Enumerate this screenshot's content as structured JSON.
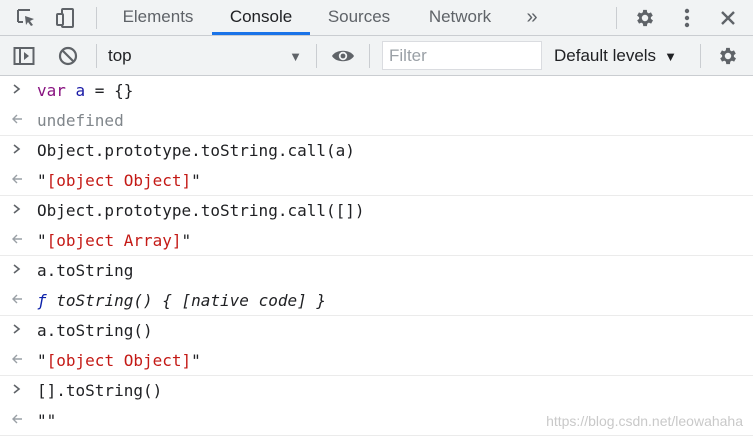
{
  "tabs": [
    {
      "label": "Elements",
      "active": false
    },
    {
      "label": "Console",
      "active": true
    },
    {
      "label": "Sources",
      "active": false
    },
    {
      "label": "Network",
      "active": false
    }
  ],
  "more_tabs_label": "»",
  "toolbar": {
    "context_value": "top",
    "filter_placeholder": "Filter",
    "levels_label": "Default levels"
  },
  "entries": [
    {
      "kind": "input",
      "parts": [
        {
          "t": "var",
          "c": "kw"
        },
        {
          "t": " a",
          "c": "var"
        },
        {
          "t": " = {}",
          "c": ""
        }
      ]
    },
    {
      "kind": "output",
      "parts": [
        {
          "t": "undefined",
          "c": "undef"
        }
      ]
    },
    {
      "kind": "input",
      "parts": [
        {
          "t": "Object.prototype.toString.call(a)",
          "c": ""
        }
      ]
    },
    {
      "kind": "output",
      "parts": [
        {
          "t": "\"",
          "c": ""
        },
        {
          "t": "[object Object]",
          "c": "str"
        },
        {
          "t": "\"",
          "c": ""
        }
      ]
    },
    {
      "kind": "input",
      "parts": [
        {
          "t": "Object.prototype.toString.call([])",
          "c": ""
        }
      ]
    },
    {
      "kind": "output",
      "parts": [
        {
          "t": "\"",
          "c": ""
        },
        {
          "t": "[object Array]",
          "c": "str"
        },
        {
          "t": "\"",
          "c": ""
        }
      ]
    },
    {
      "kind": "input",
      "parts": [
        {
          "t": "a.toString",
          "c": ""
        }
      ]
    },
    {
      "kind": "output",
      "parts": [
        {
          "t": "ƒ",
          "c": "fn-f"
        },
        {
          "t": " toString() { [native code] }",
          "c": "fn"
        }
      ]
    },
    {
      "kind": "input",
      "parts": [
        {
          "t": "a.toString()",
          "c": ""
        }
      ]
    },
    {
      "kind": "output",
      "parts": [
        {
          "t": "\"",
          "c": ""
        },
        {
          "t": "[object Object]",
          "c": "str"
        },
        {
          "t": "\"",
          "c": ""
        }
      ]
    },
    {
      "kind": "input",
      "parts": [
        {
          "t": "[].toString()",
          "c": ""
        }
      ]
    },
    {
      "kind": "output",
      "parts": [
        {
          "t": "\"\"",
          "c": ""
        }
      ]
    }
  ],
  "watermark": "https://blog.csdn.net/leowahaha",
  "colors": {
    "accent": "#1a73e8",
    "string": "#c41a16",
    "keyword": "#881280"
  },
  "icons": [
    "inspect-element-icon",
    "device-toolbar-icon",
    "settings-gear-icon",
    "more-vertical-icon",
    "close-icon",
    "sidebar-toggle-icon",
    "clear-console-icon",
    "live-expression-eye-icon",
    "console-settings-gear-icon"
  ]
}
